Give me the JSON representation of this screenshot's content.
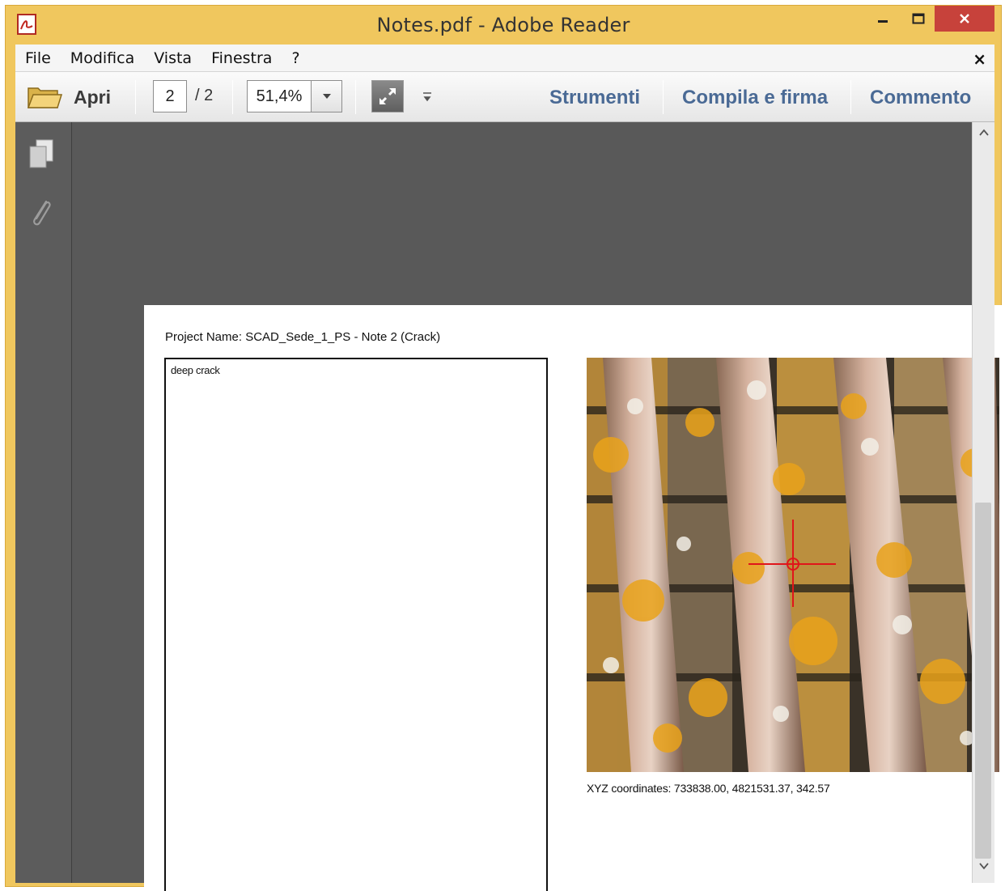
{
  "window": {
    "title": "Notes.pdf - Adobe Reader"
  },
  "menu": {
    "items": [
      "File",
      "Modifica",
      "Vista",
      "Finestra",
      "?"
    ],
    "close_glyph": "×"
  },
  "toolbar": {
    "open_label": "Apri",
    "current_page": "2",
    "total_pages": "/ 2",
    "zoom": "51,4%",
    "tools_label": "Strumenti",
    "fill_sign_label": "Compila e firma",
    "comment_label": "Commento"
  },
  "document": {
    "project_name": "Project Name: SCAD_Sede_1_PS - Note 2 (Crack)",
    "note_text": "deep crack",
    "coordinates": "XYZ coordinates: 733838.00, 4821531.37, 342.57",
    "page_number": "2"
  },
  "icons": {
    "app": "adobe-reader-icon",
    "open": "folder-icon",
    "fit": "fit-page-icon",
    "pages": "pages-icon",
    "attachments": "paperclip-icon"
  },
  "colors": {
    "frame": "#f0c75e",
    "close_button": "#c7423b",
    "tool_link": "#4a6a95",
    "doc_background": "#595959"
  }
}
